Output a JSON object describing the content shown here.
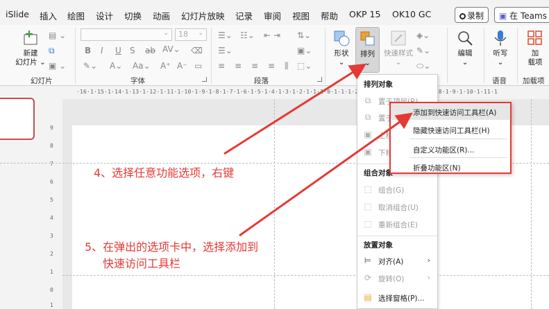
{
  "tabs": [
    {
      "label": "iSlide"
    },
    {
      "label": "插入"
    },
    {
      "label": "绘图"
    },
    {
      "label": "设计"
    },
    {
      "label": "切换"
    },
    {
      "label": "动画"
    },
    {
      "label": "幻灯片放映"
    },
    {
      "label": "记录"
    },
    {
      "label": "审阅"
    },
    {
      "label": "视图"
    },
    {
      "label": "帮助"
    },
    {
      "label": "OKP 15"
    },
    {
      "label": "OK10 GC"
    }
  ],
  "record_button": "录制",
  "teams_button": "在 Teams 中",
  "ribbon": {
    "new_slide": {
      "line1": "新建",
      "line2": "幻灯片"
    },
    "font_size": "18",
    "shape": "形状",
    "arrange": "排列",
    "quick_styles": "快速样式",
    "edit": "编辑",
    "dictate": "听写",
    "addins": {
      "line1": "加",
      "line2": "载项"
    },
    "groups": {
      "slides": "幻灯片",
      "font": "字体",
      "paragraph": "段落",
      "voice": "语音",
      "addins": "加载项"
    }
  },
  "ruler_text": "·16·1·15·1·14·1·13·1·12·1·11·1·10·1·9·1·8·1·7·1·6·1·5·1·4·1·3·1·2·1·1·1·0·1·1·1·2·1·3·1·4·1·5·1·6·1·7·1·8·1·9·1·10·1·11·1",
  "vruler": [
    "9",
    "8",
    "7",
    "6",
    "5",
    "4",
    "3",
    "2",
    "1",
    "0",
    "1"
  ],
  "arrange_menu": {
    "section_order": "排列对象",
    "bring_front": "置于顶层(R)",
    "send_back": "置于底层(K)",
    "bring_forward": "上移一层(F)",
    "send_backward": "下移一层(B)",
    "section_group": "组合对象",
    "group": "组合(G)",
    "ungroup": "取消组合(U)",
    "regroup": "重新组合(E)",
    "section_position": "放置对象",
    "align": "对齐(A)",
    "rotate": "旋转(O)",
    "selection_pane": "选择窗格(P)..."
  },
  "context_menu": {
    "add_qat": "添加到快速访问工具栏(A)",
    "hide_qat": "隐藏快速访问工具栏(H)",
    "customize_ribbon": "自定义功能区(R)...",
    "collapse_ribbon": "折叠功能区(N)"
  },
  "annotations": {
    "step4": "4、选择任意功能选项，右键",
    "step5_line1": "5、在弹出的选项卡中，选择添加到",
    "step5_line2": "快速访问工具栏"
  },
  "colors": {
    "annotation_red": "#e53935",
    "accent_orange": "#f0a030",
    "shape_blue": "#4a86c8"
  }
}
